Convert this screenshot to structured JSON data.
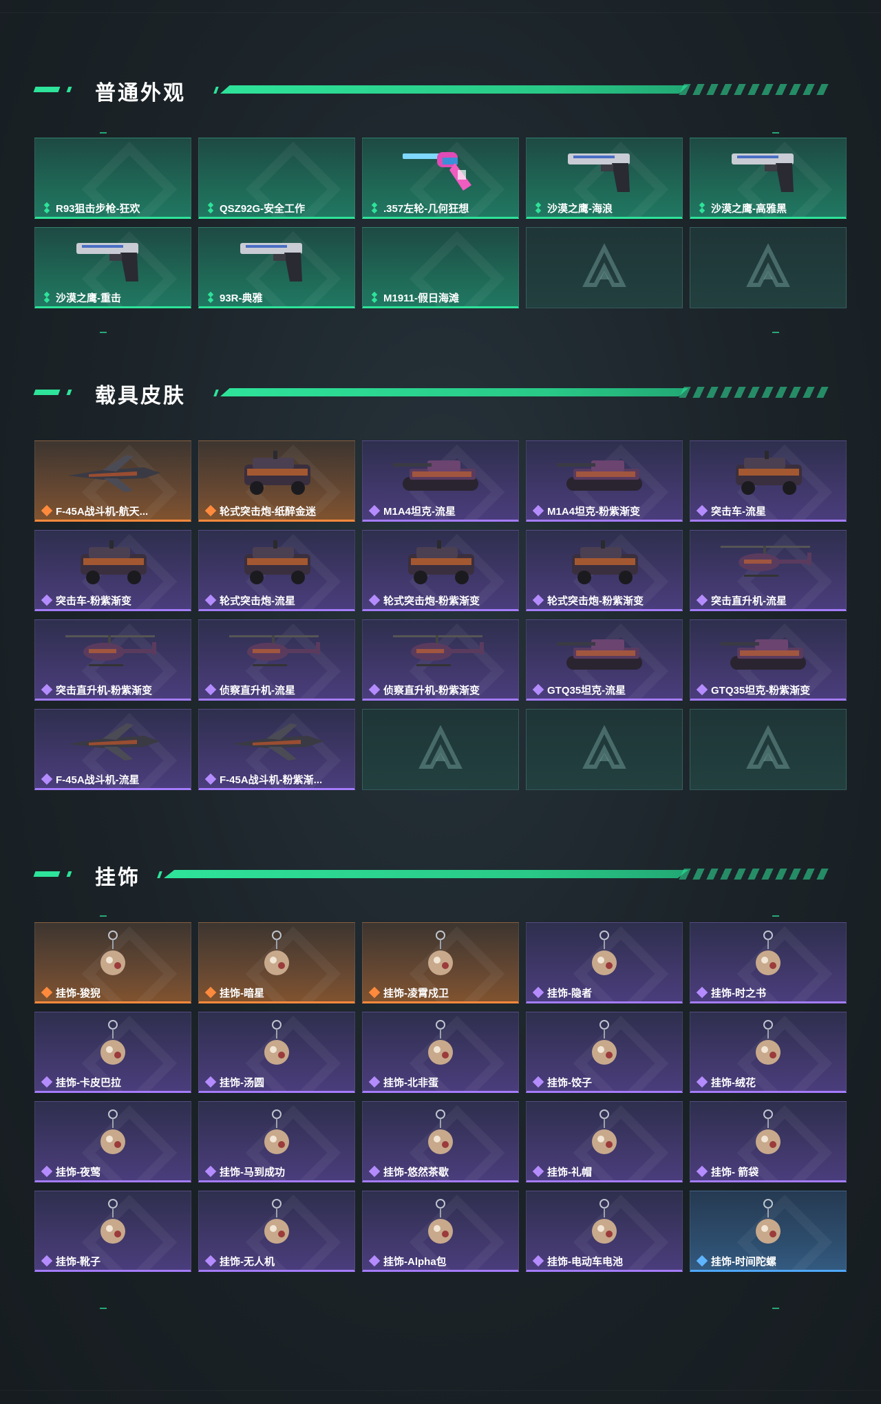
{
  "sections": [
    {
      "title": "普通外观",
      "items": [
        {
          "label": "R93狙击步枪-狂欢",
          "rarity": "green",
          "icon": "empty"
        },
        {
          "label": "QSZ92G-安全工作",
          "rarity": "green",
          "icon": "empty"
        },
        {
          "label": ".357左轮-几何狂想",
          "rarity": "green",
          "icon": "revolver-icon"
        },
        {
          "label": "沙漠之鹰-海浪",
          "rarity": "green",
          "icon": "pistol-icon"
        },
        {
          "label": "沙漠之鹰-高雅黑",
          "rarity": "green",
          "icon": "pistol-icon"
        },
        {
          "label": "沙漠之鹰-重击",
          "rarity": "green",
          "icon": "pistol-icon"
        },
        {
          "label": "93R-典雅",
          "rarity": "green",
          "icon": "pistol-icon"
        },
        {
          "label": "M1911-假日海滩",
          "rarity": "green",
          "icon": "empty"
        },
        {
          "label": "",
          "rarity": "empty",
          "icon": "placeholder-logo"
        },
        {
          "label": "",
          "rarity": "empty",
          "icon": "placeholder-logo"
        }
      ]
    },
    {
      "title": "载具皮肤",
      "items": [
        {
          "label": "F-45A战斗机-航天...",
          "rarity": "orange",
          "icon": "jet-icon"
        },
        {
          "label": "轮式突击炮-纸醉金迷",
          "rarity": "orange",
          "icon": "armored-car-icon"
        },
        {
          "label": "M1A4坦克-流星",
          "rarity": "purple",
          "icon": "tank-icon"
        },
        {
          "label": "M1A4坦克-粉紫渐变",
          "rarity": "purple",
          "icon": "tank-icon"
        },
        {
          "label": "突击车-流星",
          "rarity": "purple",
          "icon": "armored-car-icon"
        },
        {
          "label": "突击车-粉紫渐变",
          "rarity": "purple",
          "icon": "armored-car-icon"
        },
        {
          "label": "轮式突击炮-流星",
          "rarity": "purple",
          "icon": "armored-car-icon"
        },
        {
          "label": "轮式突击炮-粉紫渐变",
          "rarity": "purple",
          "icon": "armored-car-icon"
        },
        {
          "label": "轮式突击炮-粉紫渐变",
          "rarity": "purple",
          "icon": "armored-car-icon"
        },
        {
          "label": "突击直升机-流星",
          "rarity": "purple",
          "icon": "helicopter-icon"
        },
        {
          "label": "突击直升机-粉紫渐变",
          "rarity": "purple",
          "icon": "helicopter-icon"
        },
        {
          "label": "侦察直升机-流星",
          "rarity": "purple",
          "icon": "helicopter-icon"
        },
        {
          "label": "侦察直升机-粉紫渐变",
          "rarity": "purple",
          "icon": "helicopter-icon"
        },
        {
          "label": "GTQ35坦克-流星",
          "rarity": "purple",
          "icon": "tank-icon"
        },
        {
          "label": "GTQ35坦克-粉紫渐变",
          "rarity": "purple",
          "icon": "tank-icon"
        },
        {
          "label": "F-45A战斗机-流星",
          "rarity": "purple",
          "icon": "jet-icon"
        },
        {
          "label": "F-45A战斗机-粉紫渐...",
          "rarity": "purple",
          "icon": "jet-icon"
        },
        {
          "label": "",
          "rarity": "empty",
          "icon": "placeholder-logo"
        },
        {
          "label": "",
          "rarity": "empty",
          "icon": "placeholder-logo"
        },
        {
          "label": "",
          "rarity": "empty",
          "icon": "placeholder-logo"
        }
      ]
    },
    {
      "title": "挂饰",
      "items": [
        {
          "label": "挂饰-狻猊",
          "rarity": "orange",
          "icon": "charm-icon"
        },
        {
          "label": "挂饰-暗星",
          "rarity": "orange",
          "icon": "charm-icon"
        },
        {
          "label": "挂饰-凌霄戍卫",
          "rarity": "orange",
          "icon": "charm-icon"
        },
        {
          "label": "挂饰-隐者",
          "rarity": "purple",
          "icon": "charm-icon"
        },
        {
          "label": "挂饰-时之书",
          "rarity": "purple",
          "icon": "charm-icon"
        },
        {
          "label": "挂饰-卡皮巴拉",
          "rarity": "purple",
          "icon": "charm-icon"
        },
        {
          "label": "挂饰-汤圆",
          "rarity": "purple",
          "icon": "charm-icon"
        },
        {
          "label": "挂饰-北非蛋",
          "rarity": "purple",
          "icon": "charm-icon"
        },
        {
          "label": "挂饰-饺子",
          "rarity": "purple",
          "icon": "charm-icon"
        },
        {
          "label": "挂饰-绒花",
          "rarity": "purple",
          "icon": "charm-icon"
        },
        {
          "label": "挂饰-夜莺",
          "rarity": "purple",
          "icon": "charm-icon"
        },
        {
          "label": "挂饰-马到成功",
          "rarity": "purple",
          "icon": "charm-icon"
        },
        {
          "label": "挂饰-悠然茶歇",
          "rarity": "purple",
          "icon": "charm-icon"
        },
        {
          "label": "挂饰-礼帽",
          "rarity": "purple",
          "icon": "charm-icon"
        },
        {
          "label": "挂饰- 箭袋",
          "rarity": "purple",
          "icon": "charm-icon"
        },
        {
          "label": "挂饰-靴子",
          "rarity": "purple",
          "icon": "charm-icon"
        },
        {
          "label": "挂饰-无人机",
          "rarity": "purple",
          "icon": "charm-icon"
        },
        {
          "label": "挂饰-Alpha包",
          "rarity": "purple",
          "icon": "charm-icon"
        },
        {
          "label": "挂饰-电动车电池",
          "rarity": "purple",
          "icon": "charm-icon"
        },
        {
          "label": "挂饰-时间陀螺",
          "rarity": "blue",
          "icon": "charm-icon"
        }
      ]
    }
  ],
  "colors": {
    "accent": "#2ee39a",
    "green": "#2ee39a",
    "orange": "#ff8a3d",
    "purple": "#a57cff",
    "blue": "#4fa8ff"
  }
}
